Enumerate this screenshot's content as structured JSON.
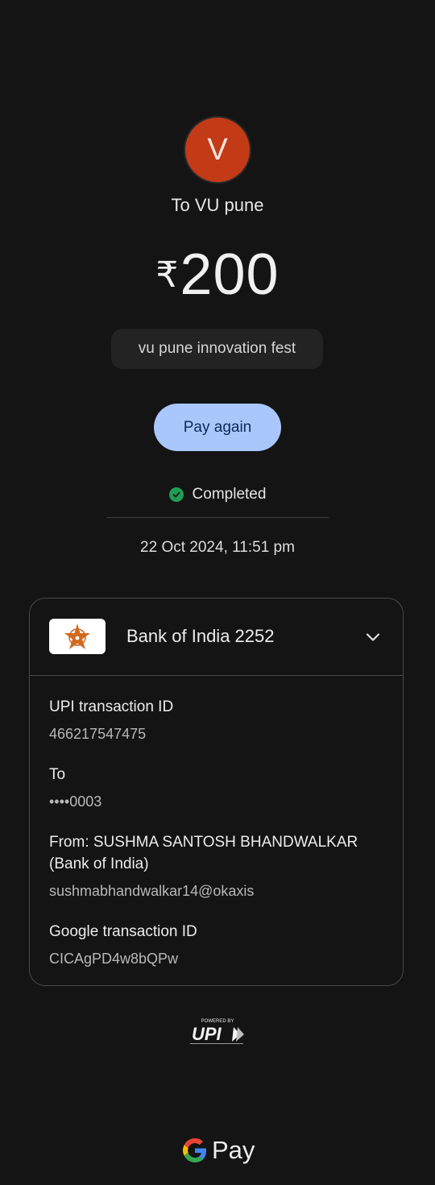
{
  "recipient": {
    "initial": "V",
    "to_label": "To VU pune",
    "avatar_color": "#c33a17"
  },
  "amount": {
    "currency_symbol": "₹",
    "value": "200"
  },
  "note": "vu pune innovation fest",
  "actions": {
    "pay_again_label": "Pay again"
  },
  "status": {
    "text": "Completed",
    "icon": "check-circle-icon",
    "color": "#1f9d55"
  },
  "datetime": "22 Oct 2024, 11:51 pm",
  "bank_card": {
    "bank_name": "Bank of India 2252",
    "logo_icon": "bank-of-india-star-logo",
    "expand_icon": "chevron-down-icon",
    "details": [
      {
        "label": "UPI transaction ID",
        "value": "466217547475"
      },
      {
        "label": "To",
        "value": "••••0003"
      },
      {
        "label": "From: SUSHMA SANTOSH BHANDWALKAR",
        "label_line2": "(Bank of India)",
        "value": "sushmabhandwalkar14@okaxis"
      },
      {
        "label": "Google transaction ID",
        "value": "CICAgPD4w8bQPw"
      }
    ]
  },
  "footer": {
    "upi_powered_by": "POWERED BY",
    "upi_logo_text": "UPI",
    "gpay_word": "Pay"
  }
}
